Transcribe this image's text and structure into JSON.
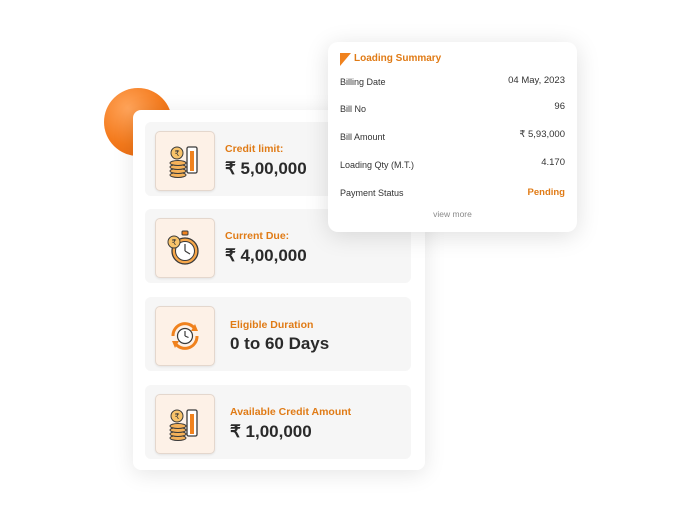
{
  "tiles": [
    {
      "label": "Credit limit:",
      "value": "₹ 5,00,000",
      "icon": "cash-card-icon"
    },
    {
      "label": "Current Due:",
      "value": "₹ 4,00,000",
      "icon": "rupee-stopwatch-icon"
    },
    {
      "label": "Eligible Duration",
      "value": "0 to 60 Days",
      "icon": "clock-cycle-icon"
    },
    {
      "label": "Available Credit Amount",
      "value": "₹ 1,00,000",
      "icon": "cash-card-icon"
    }
  ],
  "summary": {
    "title": "Loading Summary",
    "rows": [
      {
        "label": "Billing Date",
        "value": "04 May, 2023"
      },
      {
        "label": "Bill No",
        "value": "96"
      },
      {
        "label": "Bill Amount",
        "value": "₹ 5,93,000"
      },
      {
        "label": "Loading Qty (M.T.)",
        "value": "4.170"
      },
      {
        "label": "Payment Status",
        "value": "Pending"
      }
    ],
    "view_more": "view more"
  },
  "colors": {
    "accent": "#e07b16",
    "orange_circle": "#f47a1c",
    "tile_bg": "#f6f6f6",
    "text_dark": "#2a2a2a"
  }
}
